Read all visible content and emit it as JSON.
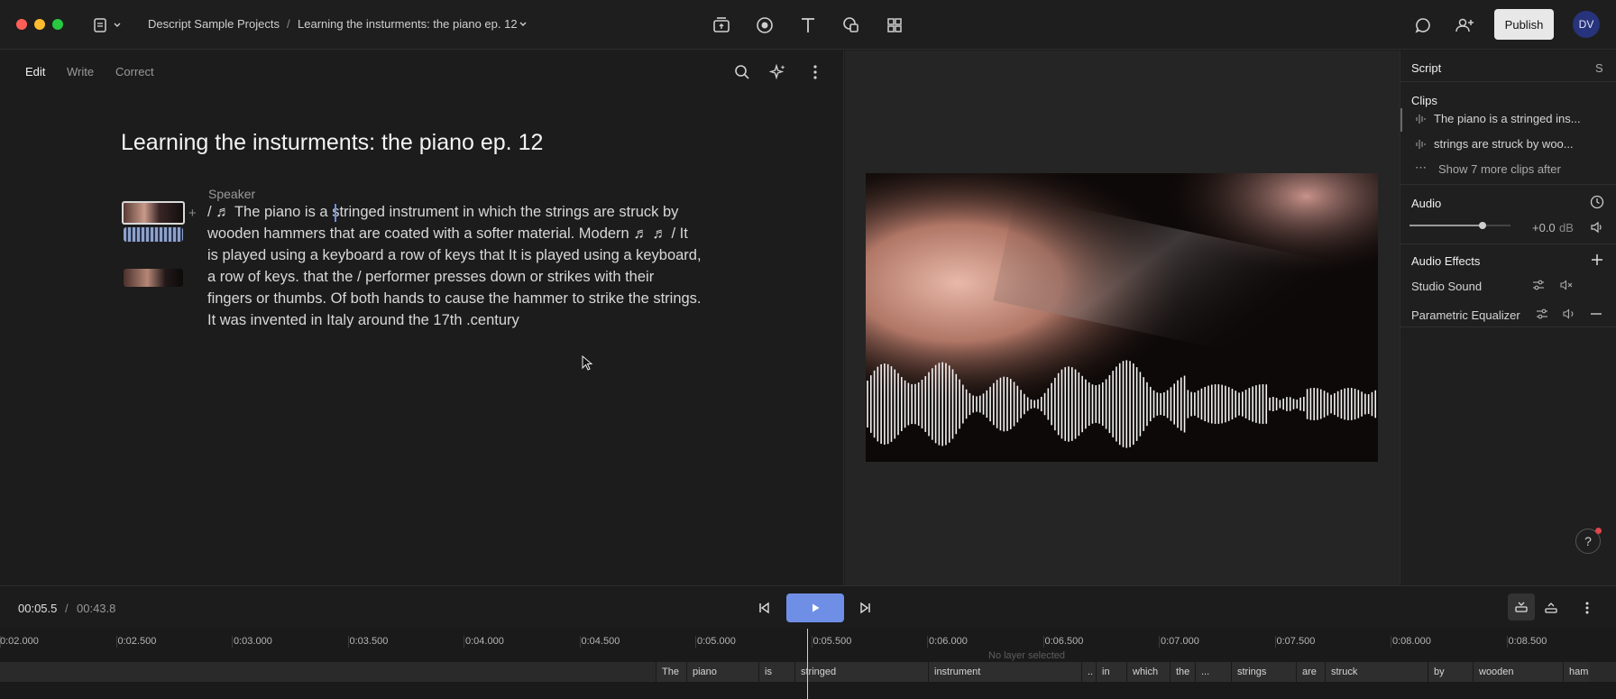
{
  "header": {
    "project": "Descript Sample Projects",
    "separator": "/",
    "composition": "Learning the insturments: the piano ep. 12",
    "publish_label": "Publish",
    "avatar_initials": "DV"
  },
  "editor": {
    "tabs": [
      "Edit",
      "Write",
      "Correct"
    ],
    "title": "Learning the insturments: the piano ep. 12",
    "speaker": "Speaker",
    "lines": [
      "/  ♬  The piano is a stringed instrument in which the strings are struck by",
      "wooden hammers that are coated with a softer material. Modern   ♬   ♬  / It",
      "is played  using a keyboard a row of keys that It is played using a keyboard,",
      "a row of keys. that the / performer presses down or strikes with their",
      "fingers or thumbs. Of both hands to cause the hammer to strike the strings.",
      "It was invented in Italy around the 17th .century"
    ]
  },
  "right_panel": {
    "script_label": "Script",
    "script_shortcut": "S",
    "clips_label": "Clips",
    "clips": [
      "The piano is a stringed ins...",
      "strings are struck by woo..."
    ],
    "more_clips": "Show 7 more clips after",
    "audio_label": "Audio",
    "volume_db": "+0.0",
    "volume_unit": "dB",
    "volume_level": 0.72,
    "effects_label": "Audio Effects",
    "effects": [
      "Studio Sound",
      "Parametric Equalizer"
    ]
  },
  "transport": {
    "current": "00:05.5",
    "sep": "/",
    "total": "00:43.8"
  },
  "timeline": {
    "ticks": [
      "0:02.000",
      "0:02.500",
      "0:03.000",
      "0:03.500",
      "0:04.000",
      "0:04.500",
      "0:05.000",
      "0:05.500",
      "0:06.000",
      "0:06.500",
      "0:07.000",
      "0:07.500",
      "0:08.000",
      "0:08.500"
    ],
    "layer_hint": "No layer selected",
    "words": [
      "The",
      "piano",
      "is",
      "stringed",
      "instrument",
      "..",
      "in",
      "which",
      "the",
      "...",
      "strings",
      "are",
      "struck",
      "by",
      "wooden",
      "ham"
    ]
  },
  "icons": {
    "transcript": "document-icon",
    "stock": "media-icon",
    "record": "record-icon",
    "text": "text-icon",
    "shapes": "shapes-icon",
    "layout": "grid-icon",
    "comments": "comment-icon",
    "share": "add-person-icon",
    "search": "search-icon",
    "ai": "sparkle-icon",
    "more": "more-icon"
  }
}
